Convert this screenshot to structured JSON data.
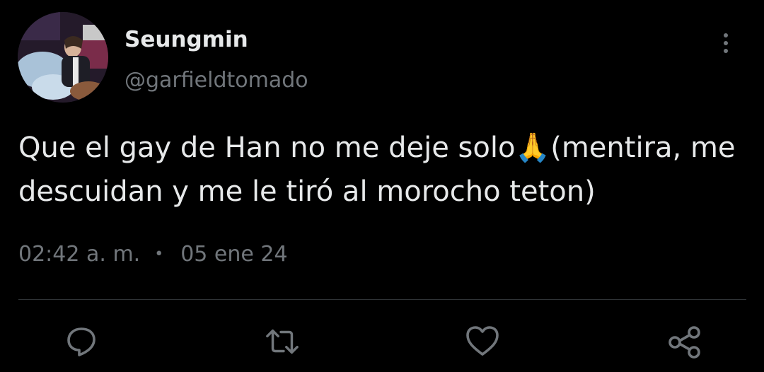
{
  "author": {
    "display_name": "Seungmin",
    "handle": "@garfieldtomado"
  },
  "tweet": {
    "text": "Que el gay de Han no me deje solo🙏(mentira, me\ndescuidan y me le tiró al morocho teton)",
    "time": "02:42 a. m.",
    "separator": "•",
    "date": "05 ene 24"
  },
  "actions": {
    "icons": [
      "reply-icon",
      "retweet-icon",
      "like-icon",
      "share-icon"
    ]
  },
  "colors": {
    "background": "#000000",
    "primary_text": "#e7e9ea",
    "secondary_text": "#71767b",
    "divider": "#2f3336"
  }
}
